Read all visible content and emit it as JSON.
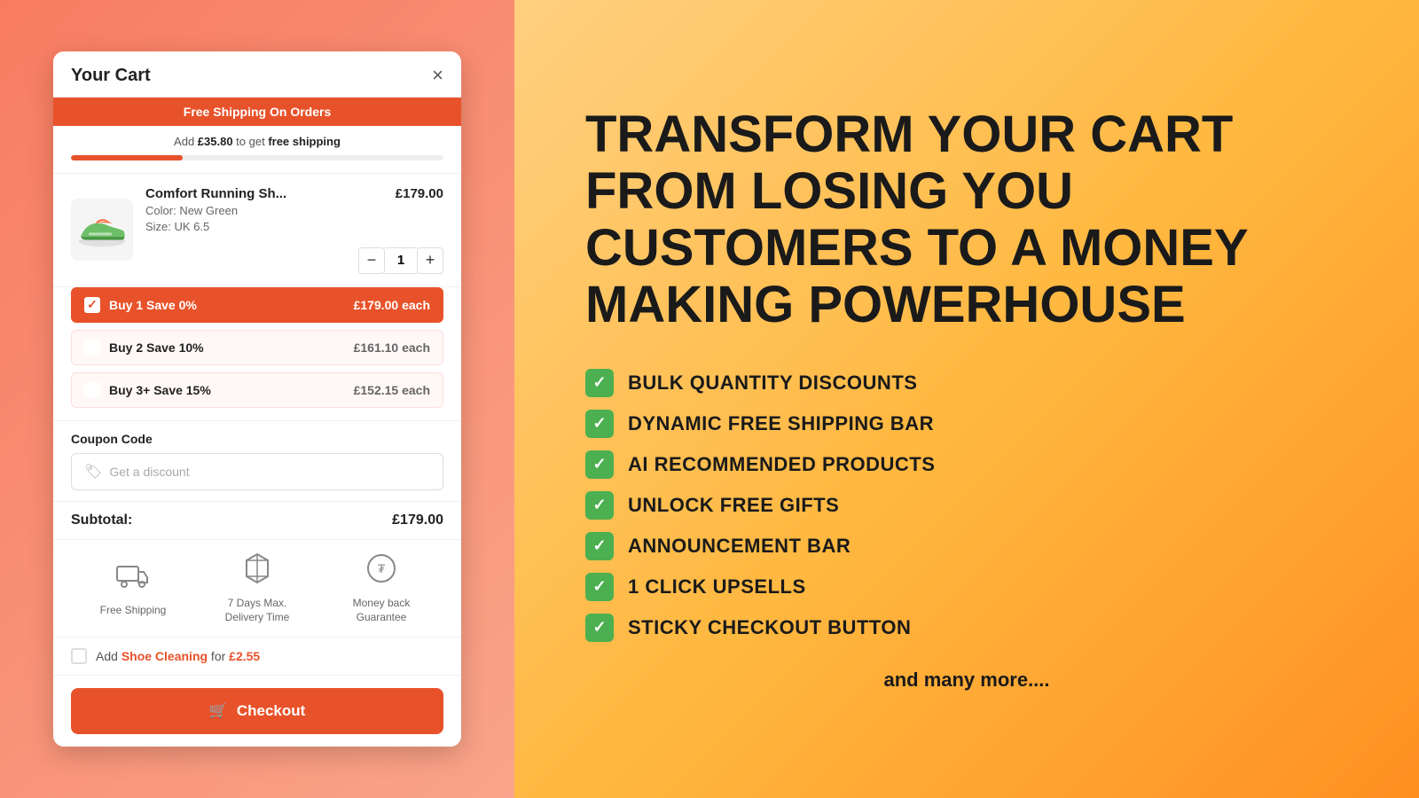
{
  "left": {
    "cart": {
      "title": "Your Cart",
      "close_label": "×",
      "shipping_banner": "Free Shipping On Orders",
      "shipping_progress_text_before": "Add ",
      "shipping_progress_amount": "£35.80",
      "shipping_progress_text_after": " to get ",
      "shipping_progress_highlight": "free shipping",
      "progress_percent": 30
    },
    "product": {
      "name": "Comfort Running Sh...",
      "price": "£179.00",
      "color_label": "Color:",
      "color_value": "New Green",
      "size_label": "Size:",
      "size_value": "UK 6.5",
      "quantity": 1
    },
    "discounts": [
      {
        "label": "Buy 1 Save 0%",
        "price": "£179.00 each",
        "active": true
      },
      {
        "label": "Buy 2 Save 10%",
        "price": "£161.10 each",
        "active": false
      },
      {
        "label": "Buy 3+ Save 15%",
        "price": "£152.15 each",
        "active": false
      }
    ],
    "coupon": {
      "label": "Coupon Code",
      "placeholder": "Get a discount"
    },
    "subtotal": {
      "label": "Subtotal:",
      "value": "£179.00"
    },
    "trust_badges": [
      {
        "icon": "🚚",
        "text": "Free Shipping"
      },
      {
        "icon": "📦",
        "text": "7 Days Max.\nDelivery Time"
      },
      {
        "icon": "🔄",
        "text": "Money back\nGuarantee"
      }
    ],
    "upsell": {
      "text_before": "Add ",
      "product": "Shoe Cleaning",
      "text_middle": " for ",
      "price": "£2.55"
    },
    "checkout": {
      "label": "Checkout"
    }
  },
  "right": {
    "hero_title": "TRANSFORM YOUR CART FROM LOSING YOU CUSTOMERS TO A MONEY MAKING POWERHOUSE",
    "features": [
      "BULK QUANTITY DISCOUNTS",
      "DYNAMIC FREE SHIPPING BAR",
      "AI RECOMMENDED PRODUCTS",
      "UNLOCK FREE GIFTS",
      "ANNOUNCEMENT BAR",
      "1 CLICK UPSELLS",
      "STICKY CHECKOUT BUTTON"
    ],
    "and_more": "and many more...."
  }
}
